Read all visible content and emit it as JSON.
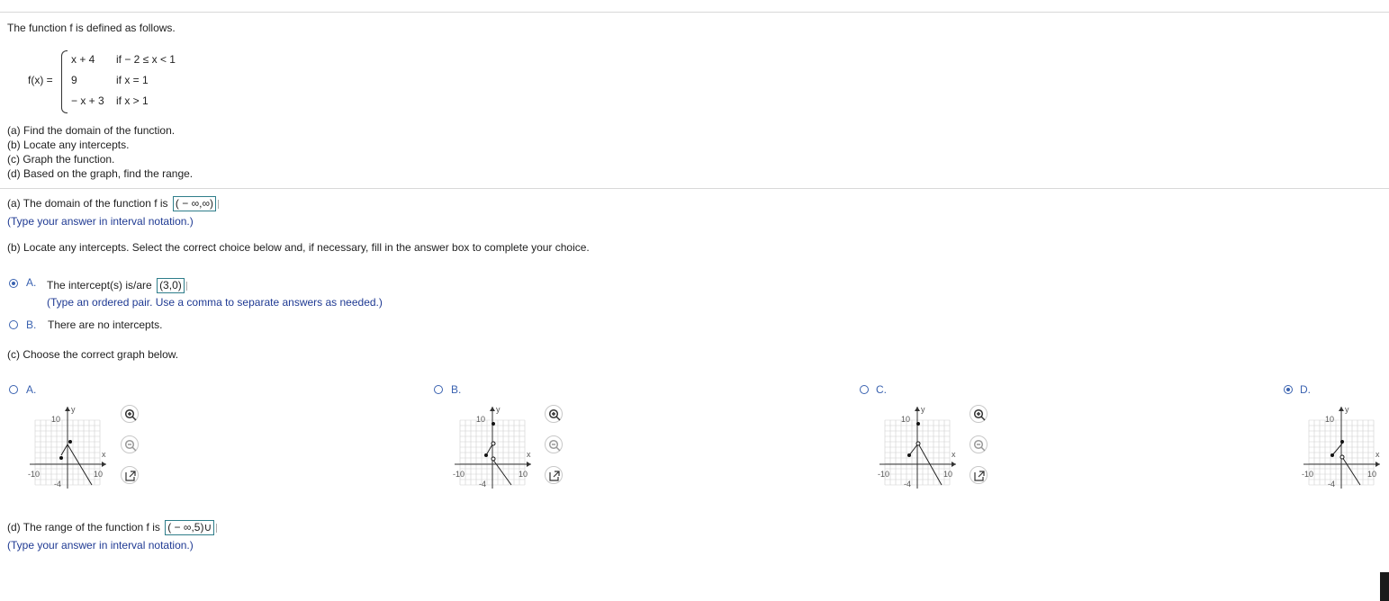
{
  "problem": {
    "intro": "The function f is defined as follows.",
    "lhs": "f(x) =",
    "pieces": [
      {
        "expr": "x + 4",
        "cond": "if  − 2 ≤ x < 1"
      },
      {
        "expr": "9",
        "cond": "if x = 1"
      },
      {
        "expr": "− x + 3",
        "cond": "if x > 1"
      }
    ],
    "tasks": [
      "(a) Find the domain of the function.",
      "(b) Locate any intercepts.",
      "(c) Graph the function.",
      "(d) Based on the graph, find the range."
    ]
  },
  "part_a": {
    "prompt": "(a) The domain of the function f is",
    "answer": "( − ∞,∞)",
    "hint": "(Type your answer in interval notation.)"
  },
  "part_b": {
    "prompt": "(b) Locate any intercepts. Select the correct choice below and, if necessary, fill in the answer box to complete your choice.",
    "choice_a": {
      "letter": "A.",
      "text": "The intercept(s) is/are",
      "answer": "(3,0)",
      "hint": "(Type an ordered pair.  Use a comma to separate answers as needed.)",
      "selected": true
    },
    "choice_b": {
      "letter": "B.",
      "text": "There are no intercepts.",
      "selected": false
    }
  },
  "part_c": {
    "prompt": "(c) Choose the correct graph below.",
    "options": [
      {
        "letter": "A.",
        "selected": false
      },
      {
        "letter": "B.",
        "selected": false
      },
      {
        "letter": "C.",
        "selected": false
      },
      {
        "letter": "D.",
        "selected": true
      }
    ],
    "axis": {
      "ymax_label": "10",
      "ymin_label": "-4",
      "xmin_label": "-10",
      "xmax_label": "10",
      "x_name": "x",
      "y_name": "y"
    },
    "icons": [
      "zoom-in-icon",
      "zoom-out-icon",
      "pop-out-icon"
    ]
  },
  "part_d": {
    "prompt": "(d) The range of the function f is",
    "answer": "( − ∞,5)∪",
    "hint": "(Type your answer in interval notation.)"
  },
  "colors": {
    "accent": "#3a62b0",
    "hint": "#1f3a93",
    "answer_border": "#2e7d8a"
  }
}
